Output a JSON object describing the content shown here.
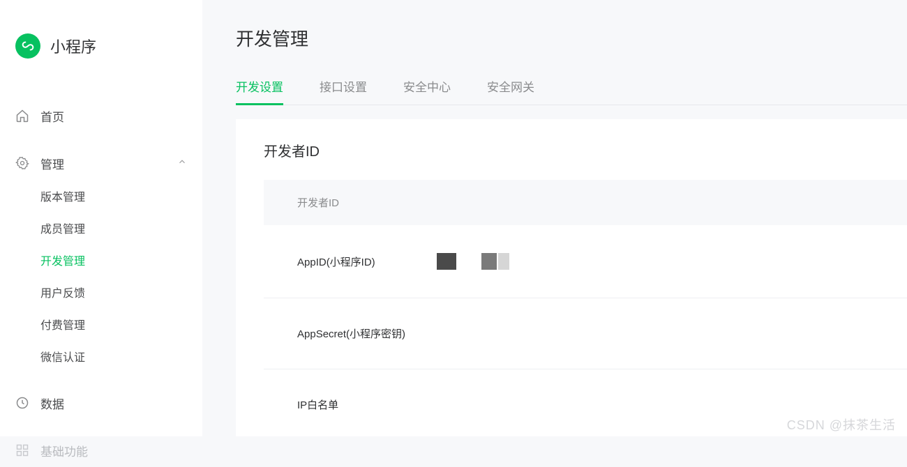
{
  "app": {
    "name": "小程序"
  },
  "sidebar": {
    "items": [
      {
        "label": "首页",
        "icon": "home"
      },
      {
        "label": "管理",
        "icon": "gear",
        "expanded": true,
        "children": [
          {
            "label": "版本管理"
          },
          {
            "label": "成员管理"
          },
          {
            "label": "开发管理",
            "active": true
          },
          {
            "label": "用户反馈"
          },
          {
            "label": "付费管理"
          },
          {
            "label": "微信认证"
          }
        ]
      },
      {
        "label": "数据",
        "icon": "clock"
      },
      {
        "label": "基础功能",
        "icon": "grid",
        "dimmed": true
      }
    ]
  },
  "page": {
    "title": "开发管理"
  },
  "tabs": [
    {
      "label": "开发设置",
      "active": true
    },
    {
      "label": "接口设置"
    },
    {
      "label": "安全中心"
    },
    {
      "label": "安全网关"
    }
  ],
  "section": {
    "title": "开发者ID",
    "header": "开发者ID",
    "rows": [
      {
        "label": "AppID(小程序ID)",
        "value_redacted": true
      },
      {
        "label": "AppSecret(小程序密钥)"
      },
      {
        "label": "IP白名单"
      }
    ]
  },
  "watermark": "CSDN @抹茶生活"
}
